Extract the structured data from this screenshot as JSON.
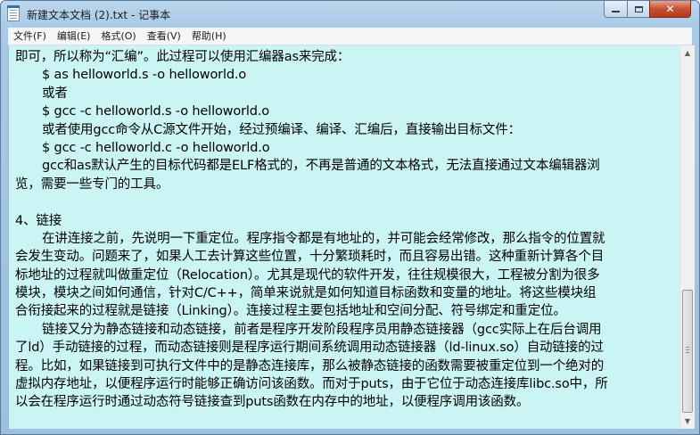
{
  "window": {
    "title": "新建文本文档 (2).txt - 记事本",
    "close_symbol": "✕"
  },
  "menu": {
    "items": [
      {
        "label": "文件(F)"
      },
      {
        "label": "编辑(E)"
      },
      {
        "label": "格式(O)"
      },
      {
        "label": "查看(V)"
      },
      {
        "label": "帮助(H)"
      }
    ]
  },
  "document": {
    "lines": [
      {
        "text": "即可，所以称为“汇编”。此过程可以使用汇编器as来完成：",
        "indent": 0
      },
      {
        "text": "$ as helloworld.s -o helloworld.o",
        "indent": 1
      },
      {
        "text": "或者",
        "indent": 1
      },
      {
        "text": "$ gcc -c helloworld.s -o helloworld.o",
        "indent": 1
      },
      {
        "text": "或者使用gcc命令从C源文件开始，经过预编译、编译、汇编后，直接输出目标文件：",
        "indent": 1
      },
      {
        "text": "$ gcc -c helloworld.c -o helloworld.o",
        "indent": 1
      },
      {
        "text": "gcc和as默认产生的目标代码都是ELF格式的，不再是普通的文本格式，无法直接通过文本编辑器浏",
        "indent": 1
      },
      {
        "text": "览，需要一些专门的工具。",
        "indent": 0
      },
      {
        "text": "",
        "indent": 0
      },
      {
        "text": "4、链接",
        "indent": 0
      },
      {
        "text": "在讲连接之前，先说明一下重定位。程序指令都是有地址的，并可能会经常修改，那么指令的位置就",
        "indent": 1
      },
      {
        "text": "会发生变动。问题来了，如果人工去计算这些位置，十分繁琐耗时，而且容易出错。这种重新计算各个目",
        "indent": 0
      },
      {
        "text": "标地址的过程就叫做重定位（Relocation）。尤其是现代的软件开发，往往规模很大，工程被分割为很多",
        "indent": 0
      },
      {
        "text": "模块，模块之间如何通信，针对C/C++，简单来说就是如何知道目标函数和变量的地址。将这些模块组",
        "indent": 0
      },
      {
        "text": "合衔接起来的过程就是链接（Linking）。连接过程主要包括地址和空间分配、符号绑定和重定位。",
        "indent": 0
      },
      {
        "text": "链接又分为静态链接和动态链接，前者是程序开发阶段程序员用静态链接器（gcc实际上在后台调用",
        "indent": 1
      },
      {
        "text": "了ld）手动链接的过程，而动态链接则是程序运行期间系统调用动态链接器（ld-linux.so）自动链接的过",
        "indent": 0
      },
      {
        "text": "程。比如，如果链接到可执行文件中的是静态连接库，那么被静态链接的函数需要被重定位到一个绝对的",
        "indent": 0
      },
      {
        "text": "虚拟内存地址，以便程序运行时能够正确访问该函数。而对于puts，由于它位于动态连接库libc.so中，所",
        "indent": 0
      },
      {
        "text": "以会在程序运行时通过动态符号链接查到puts函数在内存中的地址，以便程序调用该函数。",
        "indent": 0
      }
    ]
  },
  "colors": {
    "editor_background": "#cbf5f5",
    "text": "#000000",
    "close_button": "#c75033"
  }
}
